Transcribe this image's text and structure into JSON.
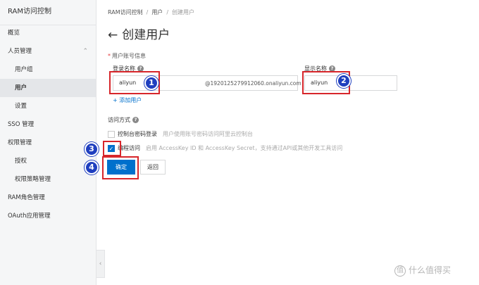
{
  "sidebar": {
    "title": "RAM访问控制",
    "items": [
      {
        "label": "概览"
      },
      {
        "label": "人员管理"
      },
      {
        "label": "用户组"
      },
      {
        "label": "用户"
      },
      {
        "label": "设置"
      },
      {
        "label": "SSO 管理"
      },
      {
        "label": "权限管理"
      },
      {
        "label": "授权"
      },
      {
        "label": "权限策略管理"
      },
      {
        "label": "RAM角色管理"
      },
      {
        "label": "OAuth应用管理"
      }
    ],
    "collapse_glyph": "‹",
    "expand_glyph": "⌃"
  },
  "breadcrumb": {
    "items": [
      "RAM访问控制",
      "用户",
      "创建用户"
    ],
    "separator": "/"
  },
  "page": {
    "back_glyph": "←",
    "title": "创建用户"
  },
  "form": {
    "required_mark": "*",
    "section_label": "用户账号信息",
    "login_name_label": "登录名称",
    "display_name_label": "显示名称",
    "help_glyph": "?",
    "login_name_value": "aliyun",
    "login_name_suffix": "@1920125279912060.onaliyun.com",
    "display_name_value": "aliyun",
    "add_user_label": "+ 添加用户",
    "access_mode_label": "访问方式",
    "console_login_label": "控制台密码登录",
    "console_login_desc": "用户使用账号密码访问阿里云控制台",
    "programmatic_label": "编程访问",
    "programmatic_desc": "启用 AccessKey ID 和 AccessKey Secret，支持通过API或其他开发工具访问",
    "console_checked": false,
    "programmatic_checked": true,
    "check_glyph": "✓",
    "ok_label": "确定",
    "back_label": "返回"
  },
  "annotations": {
    "steps": [
      "1",
      "2",
      "3",
      "4"
    ],
    "highlight_color": "#d7262b",
    "badge_color": "#1f3fbf"
  },
  "watermark": {
    "icon": "值",
    "text": "什么值得买"
  },
  "colors": {
    "primary": "#0070cc",
    "sidebar_bg": "#f5f6f7",
    "active_item_bg": "#e4e6e9"
  }
}
